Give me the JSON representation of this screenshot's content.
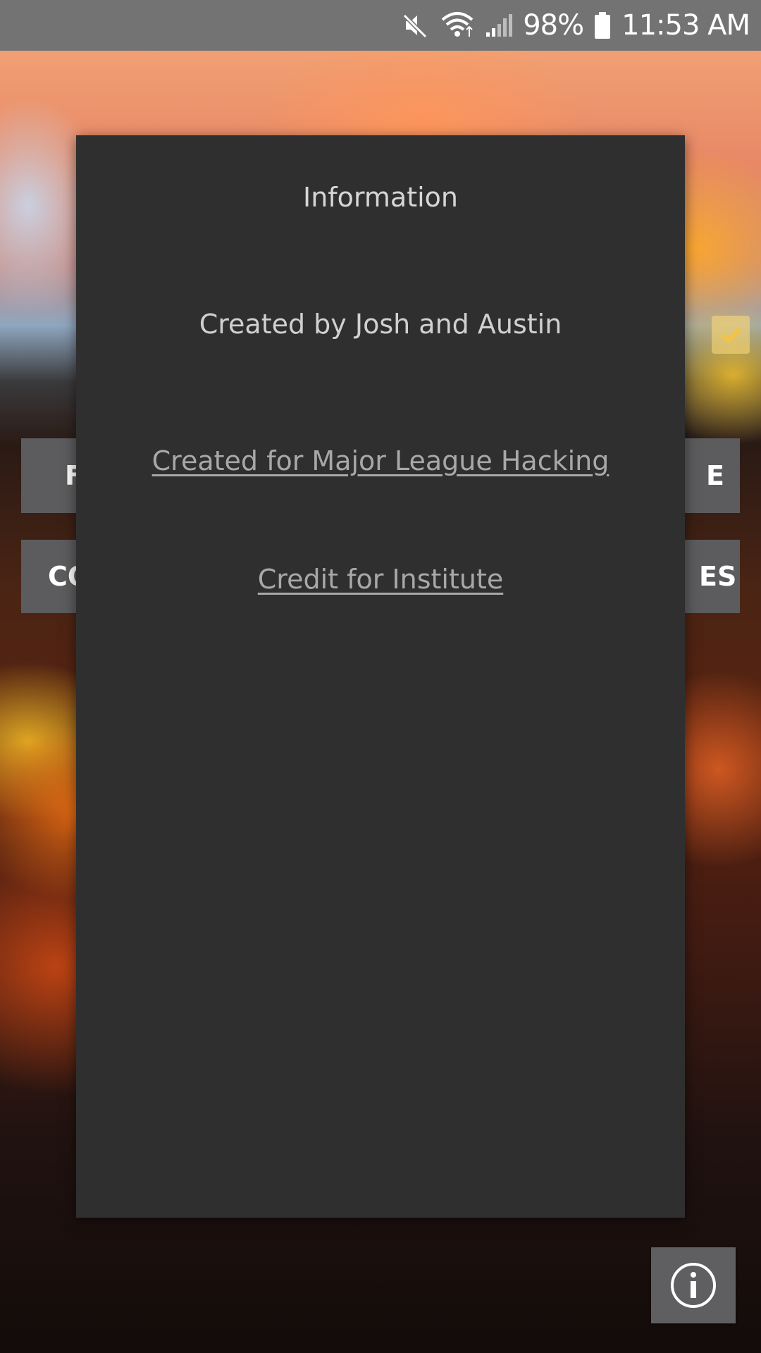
{
  "status_bar": {
    "battery": "98%",
    "time": "11:53 AM",
    "icons": [
      "mute-icon",
      "wifi-icon",
      "signal-icon",
      "battery-icon"
    ]
  },
  "background": {
    "description_colors": {
      "lava_orange": "#ff6a1a",
      "lava_yellow": "#ffcc33",
      "smoke": "#f1a074"
    }
  },
  "main_screen": {
    "button_row1_left": "F",
    "button_row1_right": "E",
    "button_row2_left": "CO",
    "button_row2_right": "ES",
    "info_button_icon": "info-icon",
    "checkbox_checked": true
  },
  "dialog": {
    "title": "Information",
    "credits": "Created by Josh and Austin",
    "link_mlh": "Created for Major League Hacking",
    "link_institute": "Credit for Institute"
  },
  "colors": {
    "status_bar_bg": "#737373",
    "dialog_bg": "#2f2f2f",
    "button_bg": "#5c5c5e",
    "link_text": "#a8a8a8"
  }
}
